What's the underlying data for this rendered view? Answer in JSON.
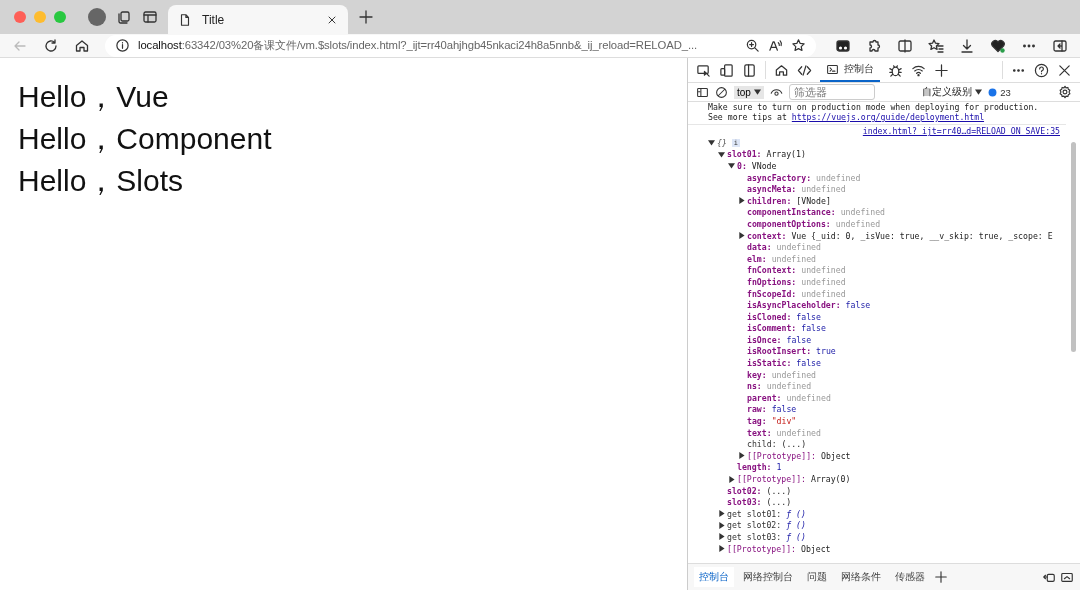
{
  "browser": {
    "tabs": [
      {
        "title": "Title",
        "selected": true
      }
    ],
    "address": {
      "host": "localhost",
      "rest": ":63342/03%20备课文件/vm.$slots/index.html?_ijt=rr40ahjhgb45nkaci24h8a5nnb&_ij_reload=RELOAD_..."
    }
  },
  "page": {
    "lines": [
      "Hello，Vue",
      "Hello，Component",
      "Hello，Slots"
    ]
  },
  "devtools": {
    "tabs": [
      {
        "label": "控制台",
        "selected": true
      }
    ],
    "context": "top",
    "filter": {
      "placeholder": "筛选器"
    },
    "levels": "自定义级别",
    "message_count": "23",
    "messages": [
      {
        "text": "Make sure to turn on production mode when deploying for production."
      },
      {
        "text": "See more tips at",
        "link": "https://vuejs.org/guide/deployment.html"
      }
    ],
    "source": "index.html?_ijt=rr40…d=RELOAD_ON_SAVE:35",
    "tree": [
      {
        "key": "{}",
        "kind": "root",
        "badge": "i",
        "expanded": true,
        "children": [
          {
            "key": "slot01:",
            "value": {
              "text": "Array(1)",
              "kind": "plain"
            },
            "kind": "own",
            "expanded": true,
            "children": [
              {
                "key": "0:",
                "value": {
                  "text": "VNode",
                  "kind": "plain"
                },
                "kind": "own",
                "expanded": true,
                "children": [
                  {
                    "key": "asyncFactory:",
                    "value": {
                      "text": "undefined",
                      "kind": "undefined"
                    },
                    "kind": "own"
                  },
                  {
                    "key": "asyncMeta:",
                    "value": {
                      "text": "undefined",
                      "kind": "undefined"
                    },
                    "kind": "own"
                  },
                  {
                    "key": "children:",
                    "value": {
                      "text": "[VNode]",
                      "kind": "plain"
                    },
                    "kind": "own",
                    "expanded": false
                  },
                  {
                    "key": "componentInstance:",
                    "value": {
                      "text": "undefined",
                      "kind": "undefined"
                    },
                    "kind": "own"
                  },
                  {
                    "key": "componentOptions:",
                    "value": {
                      "text": "undefined",
                      "kind": "undefined"
                    },
                    "kind": "own"
                  },
                  {
                    "key": "context:",
                    "value": {
                      "text": "Vue {_uid: 0, _isVue: true, __v_skip: true, _scope: E",
                      "kind": "plain"
                    },
                    "kind": "own",
                    "expanded": false
                  },
                  {
                    "key": "data:",
                    "value": {
                      "text": "undefined",
                      "kind": "undefined"
                    },
                    "kind": "own"
                  },
                  {
                    "key": "elm:",
                    "value": {
                      "text": "undefined",
                      "kind": "undefined"
                    },
                    "kind": "own"
                  },
                  {
                    "key": "fnContext:",
                    "value": {
                      "text": "undefined",
                      "kind": "undefined"
                    },
                    "kind": "own"
                  },
                  {
                    "key": "fnOptions:",
                    "value": {
                      "text": "undefined",
                      "kind": "undefined"
                    },
                    "kind": "own"
                  },
                  {
                    "key": "fnScopeId:",
                    "value": {
                      "text": "undefined",
                      "kind": "undefined"
                    },
                    "kind": "own"
                  },
                  {
                    "key": "isAsyncPlaceholder:",
                    "value": {
                      "text": "false",
                      "kind": "boolean"
                    },
                    "kind": "own"
                  },
                  {
                    "key": "isCloned:",
                    "value": {
                      "text": "false",
                      "kind": "boolean"
                    },
                    "kind": "own"
                  },
                  {
                    "key": "isComment:",
                    "value": {
                      "text": "false",
                      "kind": "boolean"
                    },
                    "kind": "own"
                  },
                  {
                    "key": "isOnce:",
                    "value": {
                      "text": "false",
                      "kind": "boolean"
                    },
                    "kind": "own"
                  },
                  {
                    "key": "isRootInsert:",
                    "value": {
                      "text": "true",
                      "kind": "boolean"
                    },
                    "kind": "own"
                  },
                  {
                    "key": "isStatic:",
                    "value": {
                      "text": "false",
                      "kind": "boolean"
                    },
                    "kind": "own"
                  },
                  {
                    "key": "key:",
                    "value": {
                      "text": "undefined",
                      "kind": "undefined"
                    },
                    "kind": "own"
                  },
                  {
                    "key": "ns:",
                    "value": {
                      "text": "undefined",
                      "kind": "undefined"
                    },
                    "kind": "own"
                  },
                  {
                    "key": "parent:",
                    "value": {
                      "text": "undefined",
                      "kind": "undefined"
                    },
                    "kind": "own"
                  },
                  {
                    "key": "raw:",
                    "value": {
                      "text": "false",
                      "kind": "boolean"
                    },
                    "kind": "own"
                  },
                  {
                    "key": "tag:",
                    "value": {
                      "text": "\"div\"",
                      "kind": "string"
                    },
                    "kind": "own"
                  },
                  {
                    "key": "text:",
                    "value": {
                      "text": "undefined",
                      "kind": "undefined"
                    },
                    "kind": "own"
                  },
                  {
                    "key": "child:",
                    "value": {
                      "text": "(...)",
                      "kind": "plain"
                    },
                    "kind": "plain"
                  },
                  {
                    "key": "[[Prototype]]:",
                    "value": {
                      "text": "Object",
                      "kind": "plain"
                    },
                    "kind": "internal",
                    "expanded": false
                  }
                ]
              },
              {
                "key": "length:",
                "value": {
                  "text": "1",
                  "kind": "number"
                },
                "kind": "own"
              },
              {
                "key": "[[Prototype]]:",
                "value": {
                  "text": "Array(0)",
                  "kind": "plain"
                },
                "kind": "internal",
                "expanded": false
              }
            ]
          },
          {
            "key": "slot02:",
            "value": {
              "text": "(...)",
              "kind": "plain"
            },
            "kind": "own"
          },
          {
            "key": "slot03:",
            "value": {
              "text": "(...)",
              "kind": "plain"
            },
            "kind": "own"
          },
          {
            "key": "get slot01:",
            "value": {
              "text": "ƒ ()",
              "kind": "function"
            },
            "kind": "plain",
            "expanded": false
          },
          {
            "key": "get slot02:",
            "value": {
              "text": "ƒ ()",
              "kind": "function"
            },
            "kind": "plain",
            "expanded": false
          },
          {
            "key": "get slot03:",
            "value": {
              "text": "ƒ ()",
              "kind": "function"
            },
            "kind": "plain",
            "expanded": false
          },
          {
            "key": "[[Prototype]]:",
            "value": {
              "text": "Object",
              "kind": "plain"
            },
            "kind": "internal",
            "expanded": false
          }
        ]
      }
    ],
    "drawer_tabs": [
      {
        "label": "控制台",
        "selected": true
      },
      {
        "label": "网络控制台",
        "selected": false
      },
      {
        "label": "问题",
        "selected": false
      },
      {
        "label": "网络条件",
        "selected": false
      },
      {
        "label": "传感器",
        "selected": false
      }
    ]
  }
}
